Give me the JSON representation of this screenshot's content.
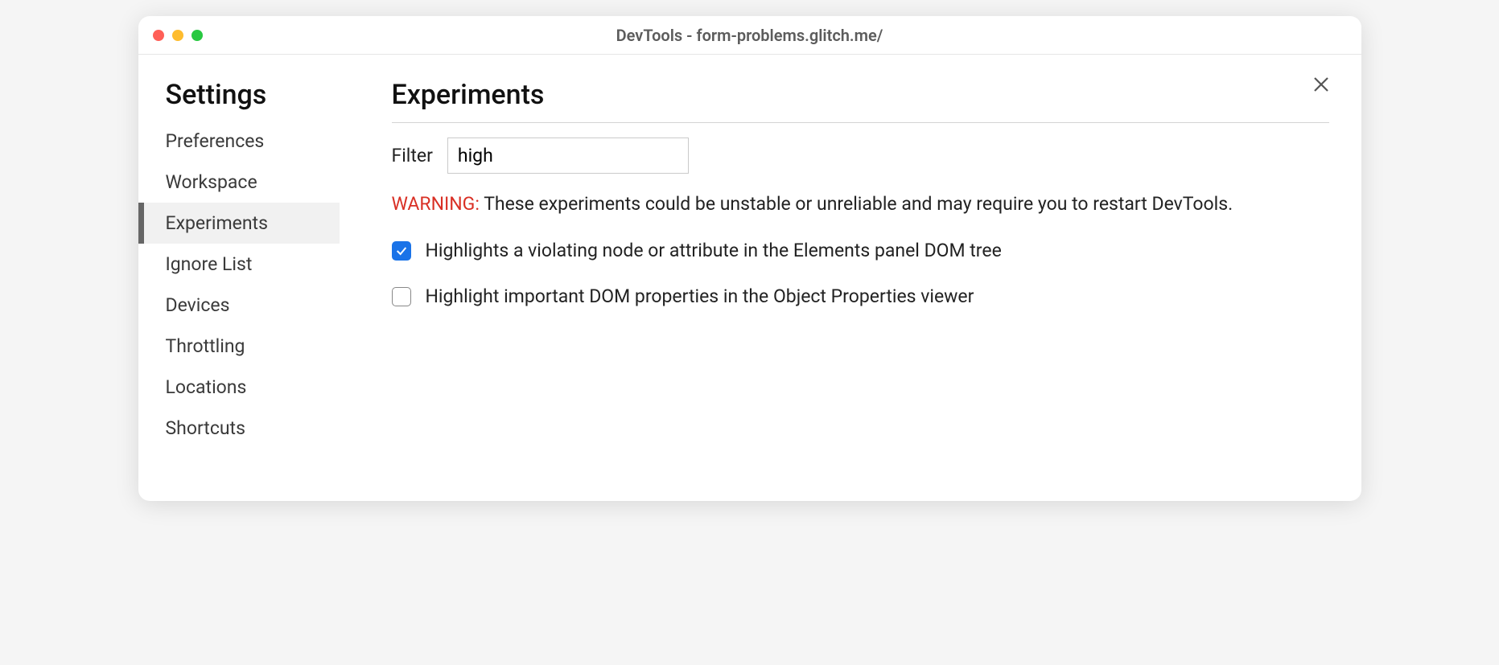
{
  "window": {
    "title": "DevTools - form-problems.glitch.me/"
  },
  "sidebar": {
    "title": "Settings",
    "items": [
      {
        "label": "Preferences",
        "active": false
      },
      {
        "label": "Workspace",
        "active": false
      },
      {
        "label": "Experiments",
        "active": true
      },
      {
        "label": "Ignore List",
        "active": false
      },
      {
        "label": "Devices",
        "active": false
      },
      {
        "label": "Throttling",
        "active": false
      },
      {
        "label": "Locations",
        "active": false
      },
      {
        "label": "Shortcuts",
        "active": false
      }
    ]
  },
  "main": {
    "title": "Experiments",
    "filter_label": "Filter",
    "filter_value": "high",
    "warning_label": "WARNING:",
    "warning_text": "These experiments could be unstable or unreliable and may require you to restart DevTools.",
    "experiments": [
      {
        "label": "Highlights a violating node or attribute in the Elements panel DOM tree",
        "checked": true
      },
      {
        "label": "Highlight important DOM properties in the Object Properties viewer",
        "checked": false
      }
    ]
  }
}
